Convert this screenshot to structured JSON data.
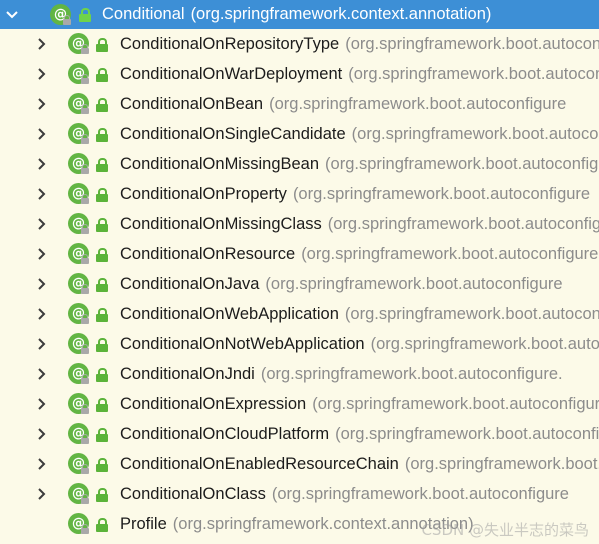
{
  "root": {
    "name": "Conditional",
    "package": "(org.springframework.context.annotation)",
    "annotation_glyph": "@",
    "icons": [
      "chevron-down-icon",
      "annotation-icon",
      "public-lock-icon"
    ]
  },
  "children": [
    {
      "name": "ConditionalOnRepositoryType",
      "package": "(org.springframework.boot.autoconfigure",
      "expandable": true
    },
    {
      "name": "ConditionalOnWarDeployment",
      "package": "(org.springframework.boot.autoconfigure",
      "expandable": true
    },
    {
      "name": "ConditionalOnBean",
      "package": "(org.springframework.boot.autoconfigure",
      "expandable": true
    },
    {
      "name": "ConditionalOnSingleCandidate",
      "package": "(org.springframework.boot.autoconfigure",
      "expandable": true
    },
    {
      "name": "ConditionalOnMissingBean",
      "package": "(org.springframework.boot.autoconfigure",
      "expandable": true
    },
    {
      "name": "ConditionalOnProperty",
      "package": "(org.springframework.boot.autoconfigure",
      "expandable": true
    },
    {
      "name": "ConditionalOnMissingClass",
      "package": "(org.springframework.boot.autoconfigure",
      "expandable": true
    },
    {
      "name": "ConditionalOnResource",
      "package": "(org.springframework.boot.autoconfigure",
      "expandable": true
    },
    {
      "name": "ConditionalOnJava",
      "package": "(org.springframework.boot.autoconfigure",
      "expandable": true
    },
    {
      "name": "ConditionalOnWebApplication",
      "package": "(org.springframework.boot.autoconfigure",
      "expandable": true
    },
    {
      "name": "ConditionalOnNotWebApplication",
      "package": "(org.springframework.boot.autoconfigure",
      "expandable": true
    },
    {
      "name": "ConditionalOnJndi",
      "package": "(org.springframework.boot.autoconfigure.",
      "expandable": true
    },
    {
      "name": "ConditionalOnExpression",
      "package": "(org.springframework.boot.autoconfigure",
      "expandable": true
    },
    {
      "name": "ConditionalOnCloudPlatform",
      "package": "(org.springframework.boot.autoconfigure",
      "expandable": true
    },
    {
      "name": "ConditionalOnEnabledResourceChain",
      "package": "(org.springframework.boot.autoconfigure",
      "expandable": true
    },
    {
      "name": "ConditionalOnClass",
      "package": "(org.springframework.boot.autoconfigure",
      "expandable": true
    },
    {
      "name": "Profile",
      "package": "(org.springframework.context.annotation)",
      "expandable": false
    }
  ],
  "watermark": "CSDN @失业半志的菜鸟",
  "colors": {
    "background": "#fcfae8",
    "selection": "#3d8fd6",
    "annotation_icon": "#62b543",
    "package_text": "#8c8c8c"
  }
}
